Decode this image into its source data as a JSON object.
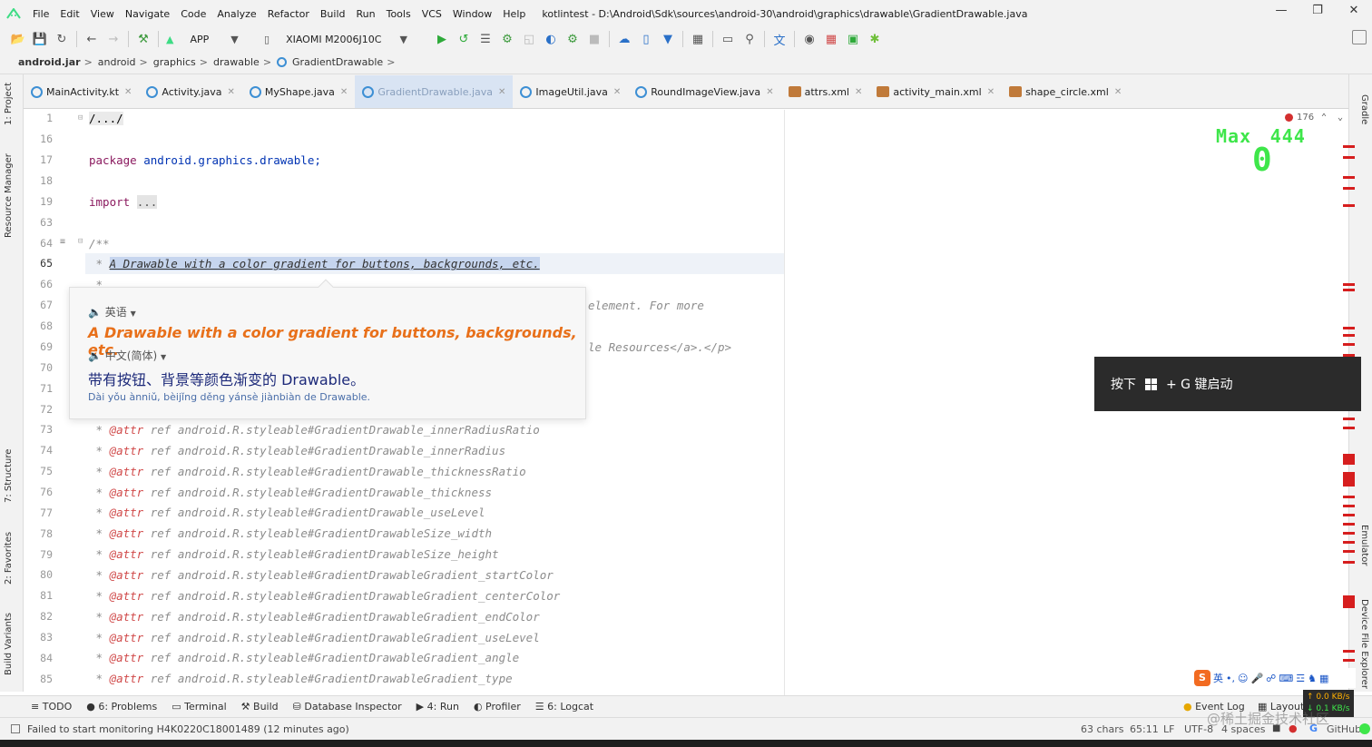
{
  "menubar": {
    "items": [
      "File",
      "Edit",
      "View",
      "Navigate",
      "Code",
      "Analyze",
      "Refactor",
      "Build",
      "Run",
      "Tools",
      "VCS",
      "Window",
      "Help"
    ],
    "title": "kotlintest - D:\\Android\\Sdk\\sources\\android-30\\android\\graphics\\drawable\\GradientDrawable.java"
  },
  "toolbar": {
    "run_config": "APP",
    "device": "XIAOMI M2006J10C"
  },
  "breadcrumb": [
    "android.jar",
    "android",
    "graphics",
    "drawable",
    "GradientDrawable"
  ],
  "tabs": [
    {
      "label": "MainActivity.kt",
      "type": "kotlin"
    },
    {
      "label": "Activity.java",
      "type": "java"
    },
    {
      "label": "MyShape.java",
      "type": "java"
    },
    {
      "label": "GradientDrawable.java",
      "type": "java"
    },
    {
      "label": "ImageUtil.java",
      "type": "java"
    },
    {
      "label": "RoundImageView.java",
      "type": "java"
    },
    {
      "label": "attrs.xml",
      "type": "xml"
    },
    {
      "label": "activity_main.xml",
      "type": "xml"
    },
    {
      "label": "shape_circle.xml",
      "type": "xml"
    }
  ],
  "left_tools": [
    "1: Project",
    "Resource Manager",
    "7: Structure",
    "2: Favorites",
    "Build Variants"
  ],
  "right_tools": [
    "Gradle",
    "Emulator",
    "Device File Explorer"
  ],
  "editor": {
    "line_numbers": [
      "1",
      "16",
      "17",
      "18",
      "19",
      "63",
      "64",
      "65",
      "66",
      "67",
      "68",
      "69",
      "70",
      "71",
      "72",
      "73",
      "74",
      "75",
      "76",
      "77",
      "78",
      "79",
      "80",
      "81",
      "82",
      "83",
      "84",
      "85"
    ],
    "current_line": "65",
    "l1": "/.../",
    "l17_kw": "package",
    "l17_rest": " android.graphics.drawable;",
    "l19_kw": "import",
    "l19_rest": "...",
    "l64": "/**",
    "l65_star": " * ",
    "l65_text": "A Drawable with a color gradient for buttons, backgrounds, etc.",
    "l66": " *",
    "l67_tail": "element. For more",
    "l69_tail": "le Resources</a>.</p>",
    "attr_lines": [
      "android.R.styleable#GradientDrawable_innerRadiusRatio",
      "android.R.styleable#GradientDrawable_innerRadius",
      "android.R.styleable#GradientDrawable_thicknessRatio",
      "android.R.styleable#GradientDrawable_thickness",
      "android.R.styleable#GradientDrawable_useLevel",
      "android.R.styleable#GradientDrawableSize_width",
      "android.R.styleable#GradientDrawableSize_height",
      "android.R.styleable#GradientDrawableGradient_startColor",
      "android.R.styleable#GradientDrawableGradient_centerColor",
      "android.R.styleable#GradientDrawableGradient_endColor",
      "android.R.styleable#GradientDrawableGradient_useLevel",
      "android.R.styleable#GradientDrawableGradient_angle",
      "android.R.styleable#GradientDrawableGradient_type"
    ],
    "attr_tag": "@attr",
    "attr_ref": "ref",
    "errors": "176"
  },
  "memory": {
    "label": "Max",
    "max": "444",
    "value": "0"
  },
  "popup": {
    "src_lang": "英语",
    "src_text": "A Drawable with a color gradient for buttons, backgrounds, etc.",
    "dst_lang": "中文(简体)",
    "dst_text": "带有按钮、背景等颜色渐变的 Drawable。",
    "pinyin": "Dài yǒu ànniǔ, bèijǐng děng yánsè jiànbiàn de Drawable."
  },
  "toast": {
    "prefix": "按下",
    "suffix": "+ G 键启动"
  },
  "bottom_tools": [
    "TODO",
    "6: Problems",
    "Terminal",
    "Build",
    "Database Inspector",
    "4: Run",
    "Profiler",
    "6: Logcat",
    "Event Log",
    "Layout"
  ],
  "statusbar": {
    "message": "Failed to start monitoring H4K0220C18001489 (12 minutes ago)",
    "chars": "63 chars",
    "pos": "65:11",
    "le": "LF",
    "enc": "UTF-8",
    "indent": "4 spaces",
    "vcs": "GitHub"
  },
  "ime": {
    "text": "英"
  },
  "netspeed": {
    "up": "0.0 KB/s",
    "down": "0.1 KB/s"
  },
  "watermark": "@稀土掘金技术社区",
  "colors": {
    "accent_green": "#3ee64a",
    "error_red": "#d61e1e",
    "popup_orange": "#e8701a"
  }
}
